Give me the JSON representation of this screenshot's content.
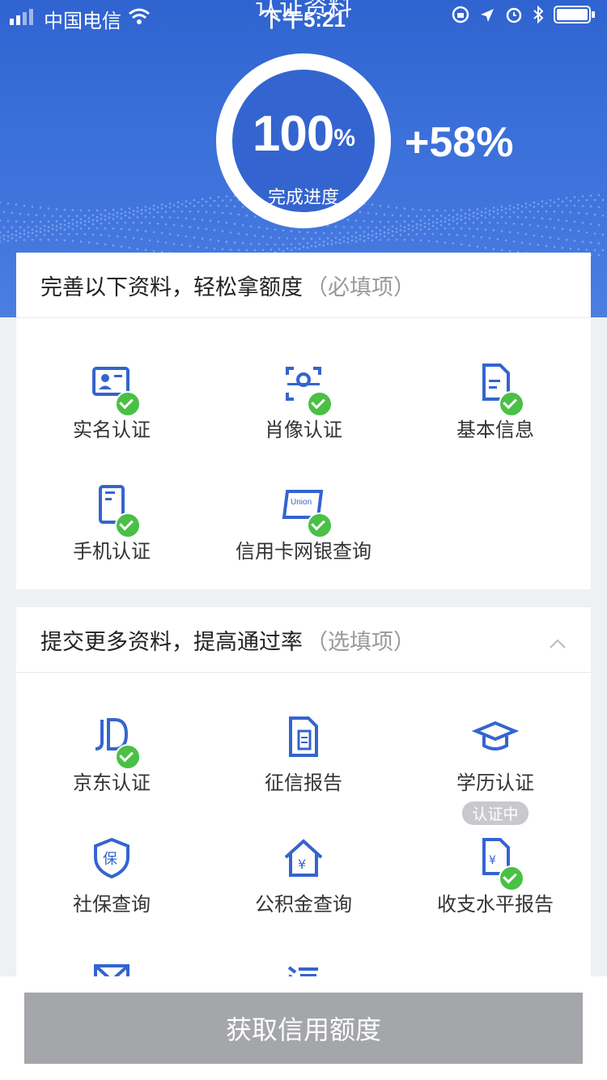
{
  "status_bar": {
    "carrier": "中国电信",
    "time": "下午5:21",
    "title": "认证资料"
  },
  "progress": {
    "value": "100",
    "unit": "%",
    "label": "完成进度",
    "delta": "+58%",
    "fraction": 1.0
  },
  "required_section": {
    "title": "完善以下资料，轻松拿额度",
    "note": "（必填项）",
    "items": [
      {
        "label": "实名认证",
        "icon": "id-card-icon",
        "done": true
      },
      {
        "label": "肖像认证",
        "icon": "face-scan-icon",
        "done": true
      },
      {
        "label": "基本信息",
        "icon": "document-icon",
        "done": true
      },
      {
        "label": "手机认证",
        "icon": "phone-icon",
        "done": true
      },
      {
        "label": "信用卡网银查询",
        "icon": "credit-card-icon",
        "done": true
      }
    ]
  },
  "optional_section": {
    "title": "提交更多资料，提高通过率",
    "note": "（选填项）",
    "items": [
      {
        "label": "京东认证",
        "icon": "jd-icon",
        "done": true
      },
      {
        "label": "征信报告",
        "icon": "credit-report-icon",
        "done": false
      },
      {
        "label": "学历认证",
        "icon": "graduation-cap-icon",
        "done": false,
        "badge": "认证中"
      },
      {
        "label": "社保查询",
        "icon": "social-security-icon",
        "done": false
      },
      {
        "label": "公积金查询",
        "icon": "housing-fund-icon",
        "done": false
      },
      {
        "label": "收支水平报告",
        "icon": "income-report-icon",
        "done": true
      }
    ]
  },
  "footer": {
    "button_label": "获取信用额度"
  },
  "colors": {
    "primary": "#3464cf",
    "success": "#4ac046",
    "disabled_button": "#a4a6aa"
  }
}
